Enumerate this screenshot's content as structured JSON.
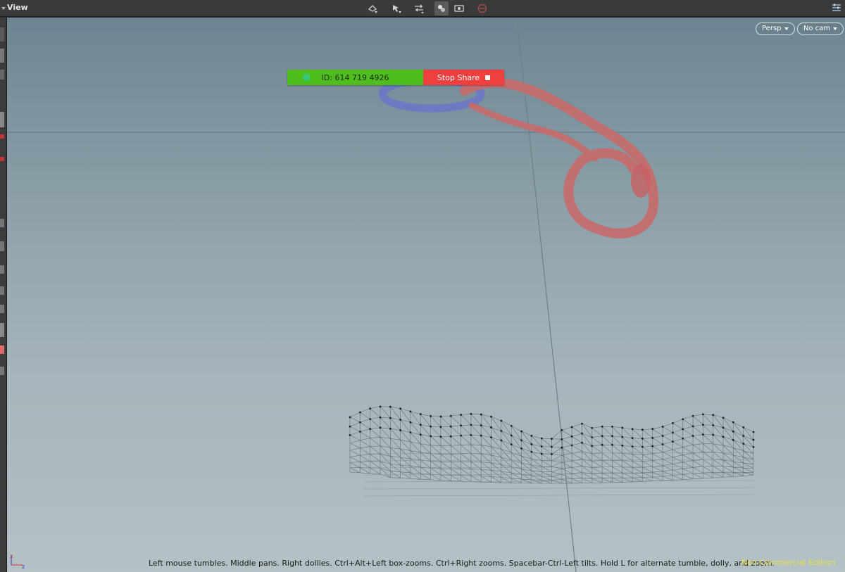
{
  "window": {
    "title": "View"
  },
  "toolbar": {
    "icons": [
      "tumble-tool-icon",
      "select-tool-icon",
      "transform-tool-icon",
      "view-mode-icon",
      "snapshot-icon",
      "disabled-icon",
      "pane-settings-icon"
    ]
  },
  "viewport": {
    "projection_label": "Persp",
    "camera_label": "No cam",
    "hint_text": "Left mouse tumbles. Middle pans. Right dollies. Ctrl+Alt+Left box-zooms. Ctrl+Right zooms. Spacebar-Ctrl-Left tilts. Hold L for alternate tumble, dolly, and zoom.",
    "edition_label": "Non-Commercial Edition",
    "axis_labels": {
      "x": "x",
      "z": "z"
    }
  },
  "share_banner": {
    "meeting_id": "ID: 614 719 4926",
    "stop_label": "Stop Share"
  },
  "colors": {
    "share_green": "#4ebd1d",
    "share_red": "#f03f3f",
    "edition_yellow": "#e8e24a",
    "viewport_top": "#6d8592",
    "viewport_bottom": "#b4c1c5"
  }
}
